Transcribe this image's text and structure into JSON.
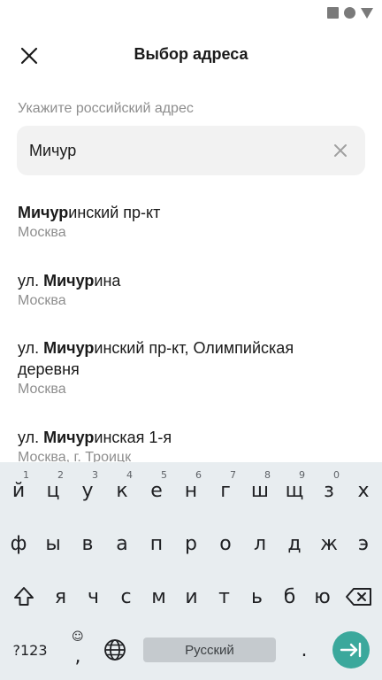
{
  "header": {
    "title": "Выбор адреса"
  },
  "search": {
    "label": "Укажите российский адрес",
    "value": "Мичур"
  },
  "results": [
    {
      "prefix": "",
      "match": "Мичур",
      "rest": "инский пр-кт",
      "subtitle": "Москва"
    },
    {
      "prefix": "ул. ",
      "match": "Мичур",
      "rest": "ина",
      "subtitle": "Москва"
    },
    {
      "prefix": "ул. ",
      "match": "Мичур",
      "rest": "инский пр-кт, Олимпийская деревня",
      "subtitle": "Москва"
    },
    {
      "prefix": "ул. ",
      "match": "Мичур",
      "rest": "инская 1-я",
      "subtitle": "Москва, г. Троицк"
    }
  ],
  "keyboard": {
    "row1": [
      "й",
      "ц",
      "у",
      "к",
      "е",
      "н",
      "г",
      "ш",
      "щ",
      "з",
      "х"
    ],
    "row1_hints": [
      "1",
      "2",
      "3",
      "4",
      "5",
      "6",
      "7",
      "8",
      "9",
      "0",
      ""
    ],
    "row2": [
      "ф",
      "ы",
      "в",
      "а",
      "п",
      "р",
      "о",
      "л",
      "д",
      "ж",
      "э"
    ],
    "row3": [
      "я",
      "ч",
      "с",
      "м",
      "и",
      "т",
      "ь",
      "б",
      "ю"
    ],
    "symbols_label": "?123",
    "comma": ",",
    "space_label": "Русский",
    "period": "."
  },
  "colors": {
    "accent": "#3ba89c",
    "keyboard_bg": "#e8edf0",
    "field_bg": "#f2f2f2",
    "muted_text": "#8e8e8e"
  }
}
